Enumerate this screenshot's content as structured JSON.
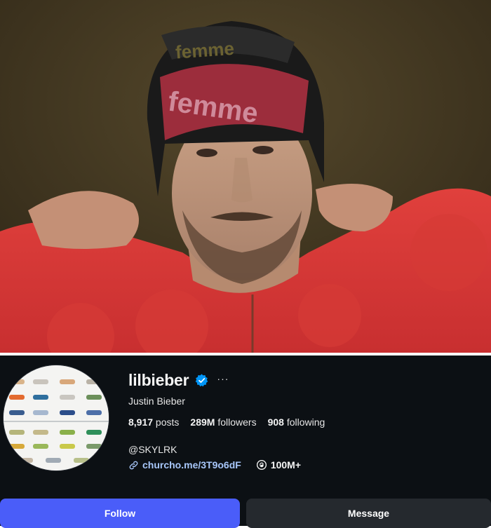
{
  "profile": {
    "username": "lilbieber",
    "full_name": "Justin Bieber",
    "verified": true,
    "stats": {
      "posts_count": "8,917",
      "posts_label": " posts",
      "followers_count": "289M",
      "followers_label": " followers",
      "following_count": "908",
      "following_label": " following"
    },
    "bio_handle": "@SKYLRK",
    "link": "churcho.me/3T9o6dF",
    "threads_count": "100M+"
  },
  "actions": {
    "follow_label": "Follow",
    "message_label": "Message"
  },
  "colors": {
    "background": "#0c1014",
    "follow_button": "#4a5df9",
    "message_button": "#25292e",
    "link": "#a8c7fa",
    "verified_badge": "#0095f6"
  },
  "icons": {
    "verified": "verified-badge-icon",
    "more": "more-options-icon",
    "link": "link-icon",
    "threads": "threads-icon"
  }
}
